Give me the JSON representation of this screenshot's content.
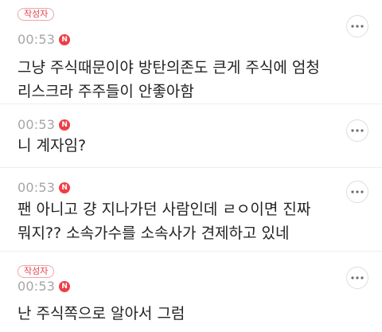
{
  "comments": [
    {
      "author_badge": "작성자",
      "time": "00:53",
      "new_badge": "N",
      "text": "그냥 주식때문이야 방탄의존도 큰게 주식에 엄청 리스크라 주주들이 안좋아함"
    },
    {
      "time": "00:53",
      "new_badge": "N",
      "text": "니 계자임?"
    },
    {
      "time": "00:53",
      "new_badge": "N",
      "text": "팬 아니고 걍 지나가던 사람인데 ㄹㅇ이면 진짜 뭐지?? 소속가수를 소속사가 견제하고 있네"
    },
    {
      "author_badge": "작성자",
      "time": "00:53",
      "new_badge": "N",
      "text": "난 주식쪽으로 알아서 그럼"
    }
  ],
  "icons": {
    "more": "more-options-icon"
  },
  "colors": {
    "accent_red": "#ee3e45",
    "time_gray": "#a6a6a6"
  }
}
